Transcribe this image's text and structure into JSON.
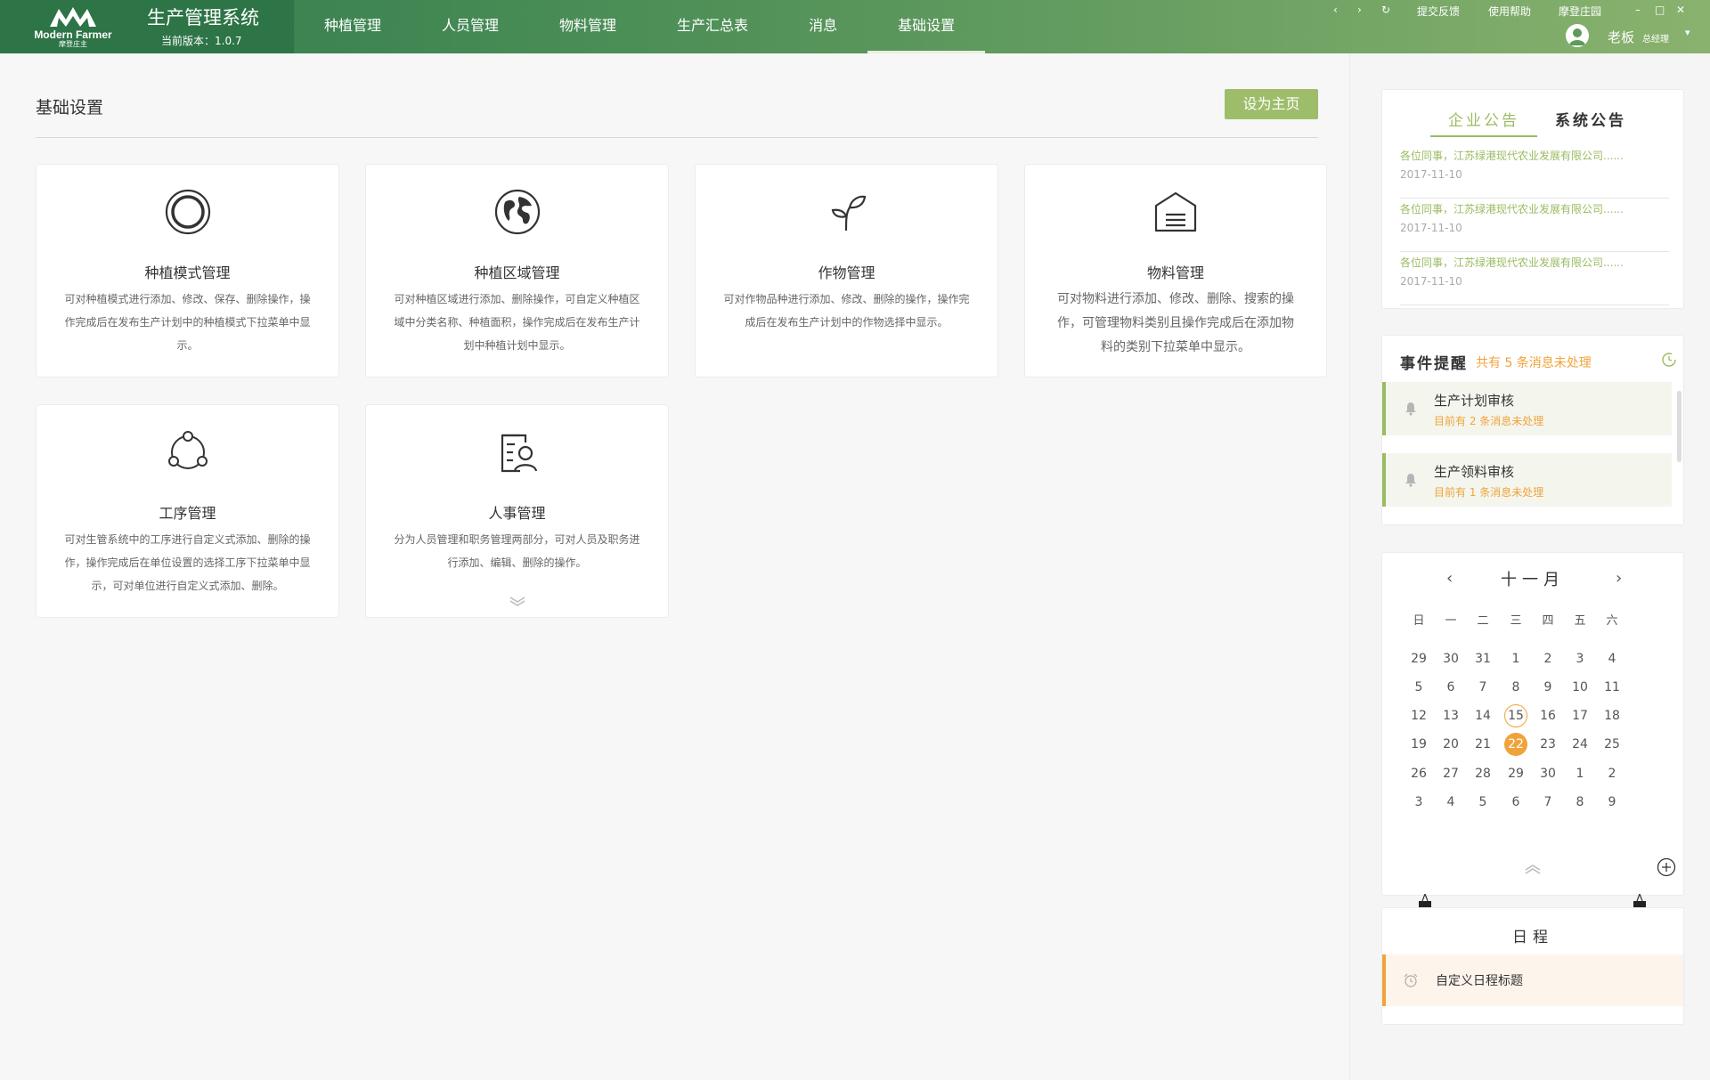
{
  "header": {
    "logo_en": "Modern Farmer",
    "logo_cn": "摩登庄主",
    "system_title": "生产管理系统",
    "version": "当前版本：1.0.7",
    "nav": [
      {
        "label": "种植管理"
      },
      {
        "label": "人员管理"
      },
      {
        "label": "物料管理"
      },
      {
        "label": "生产汇总表"
      },
      {
        "label": "消息"
      },
      {
        "label": "基础设置",
        "active": true
      }
    ],
    "links": {
      "feedback": "提交反馈",
      "help": "使用帮助",
      "estate": "摩登庄园"
    },
    "user": {
      "name": "老板",
      "role": "总经理"
    }
  },
  "main": {
    "title": "基础设置",
    "set_home_label": "设为主页",
    "cards": [
      {
        "icon": "planting-mode-icon",
        "title": "种植模式管理",
        "desc": "可对种植模式进行添加、修改、保存、删除操作，操作完成后在发布生产计划中的种植模式下拉菜单中显示。"
      },
      {
        "icon": "planting-area-icon",
        "title": "种植区域管理",
        "desc": "可对种植区域进行添加、删除操作，可自定义种植区域中分类名称、种植面积，操作完成后在发布生产计划中种植计划中显示。"
      },
      {
        "icon": "crop-sprout-icon",
        "title": "作物管理",
        "desc": "可对作物品种进行添加、修改、删除的操作，操作完成后在发布生产计划中的作物选择中显示。"
      },
      {
        "icon": "warehouse-icon",
        "title": "物料管理",
        "desc": "可对物料进行添加、修改、删除、搜索的操作，可管理物料类别且操作完成后在添加物料的类别下拉菜单中显示。"
      },
      {
        "icon": "process-cycle-icon",
        "title": "工序管理",
        "desc": "可对生管系统中的工序进行自定义式添加、删除的操作，操作完成后在单位设置的选择工序下拉菜单中显示，可对单位进行自定义式添加、删除。"
      },
      {
        "icon": "personnel-icon",
        "title": "人事管理",
        "desc": "分为人员管理和职务管理两部分，可对人员及职务进行添加、编辑、删除的操作。"
      }
    ]
  },
  "announcements": {
    "tabs": [
      {
        "label": "企业公告",
        "active": true
      },
      {
        "label": "系统公告"
      }
    ],
    "items": [
      {
        "text": "各位同事，江苏绿港现代农业发展有限公司......",
        "date": "2017-11-10"
      },
      {
        "text": "各位同事，江苏绿港现代农业发展有限公司......",
        "date": "2017-11-10"
      },
      {
        "text": "各位同事，江苏绿港现代农业发展有限公司......",
        "date": "2017-11-10"
      }
    ]
  },
  "events": {
    "title": "事件提醒",
    "summary": "共有 5 条消息未处理",
    "items": [
      {
        "title": "生产计划审核",
        "sub": "目前有   2   条消息未处理"
      },
      {
        "title": "生产领料审核",
        "sub": "目前有   1   条消息未处理"
      }
    ]
  },
  "calendar": {
    "month": "十一月",
    "weekdays": [
      "日",
      "一",
      "二",
      "三",
      "四",
      "五",
      "六"
    ],
    "weeks": [
      [
        "29",
        "30",
        "31",
        "1",
        "2",
        "3",
        "4"
      ],
      [
        "5",
        "6",
        "7",
        "8",
        "9",
        "10",
        "11"
      ],
      [
        "12",
        "13",
        "14",
        "15",
        "16",
        "17",
        "18"
      ],
      [
        "19",
        "20",
        "21",
        "22",
        "23",
        "24",
        "25"
      ],
      [
        "26",
        "27",
        "28",
        "29",
        "30",
        "1",
        "2"
      ],
      [
        "3",
        "4",
        "5",
        "6",
        "7",
        "8",
        "9"
      ]
    ],
    "today": "15",
    "selected": "22",
    "accent": "#f0a33b"
  },
  "schedule": {
    "title": "日程",
    "item": "自定义日程标题"
  },
  "colors": {
    "brand_green": "#2d7446",
    "accent_green": "#9bbb62",
    "accent_orange": "#f0a33b"
  }
}
